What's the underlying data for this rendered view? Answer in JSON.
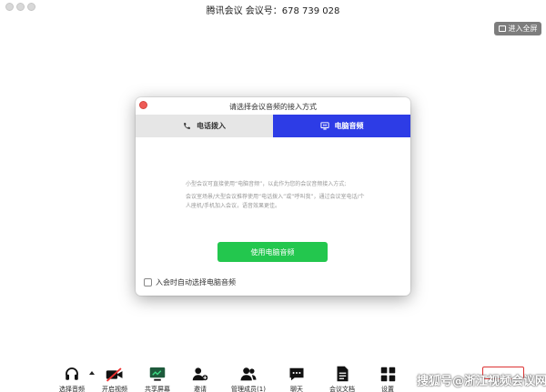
{
  "window": {
    "title": "腾讯会议 会议号：678 739 028"
  },
  "fullscreen": {
    "label": "进入全屏",
    "icon": "fullscreen-icon"
  },
  "dialog": {
    "title": "请选择会议音频的接入方式",
    "tabs": [
      {
        "label": "电话拨入",
        "icon": "phone-icon",
        "active": false
      },
      {
        "label": "电脑音频",
        "icon": "computer-audio-icon",
        "active": true
      }
    ],
    "desc_line1": "小型会议可直接使用“电脑音频”，以此作为您的会议音频接入方式;",
    "desc_line2": "会议室场景/大型会议推荐使用“电话拨入”或“呼叫我”，通过会议室电话/个人座机/手机加入会议，语音效果更佳。",
    "use_button": "使用电脑音频",
    "auto_select_label": "入会时自动选择电脑音频",
    "auto_select_checked": false
  },
  "toolbar": {
    "items": [
      {
        "label": "选择音频",
        "icon": "headset-icon"
      },
      {
        "label": "开启视频",
        "icon": "video-off-icon"
      },
      {
        "label": "共享屏幕",
        "icon": "share-screen-icon"
      },
      {
        "label": "邀请",
        "icon": "invite-icon"
      },
      {
        "label": "管理成员(1)",
        "icon": "members-icon"
      },
      {
        "label": "聊天",
        "icon": "chat-icon"
      },
      {
        "label": "会议文档",
        "icon": "document-icon"
      },
      {
        "label": "设置",
        "icon": "settings-icon"
      }
    ]
  },
  "watermark": {
    "text": "搜狐号@浙江视频会议网"
  },
  "colors": {
    "accent_blue": "#2d3ce6",
    "button_green": "#23c74e",
    "close_red": "#ee5b57"
  }
}
